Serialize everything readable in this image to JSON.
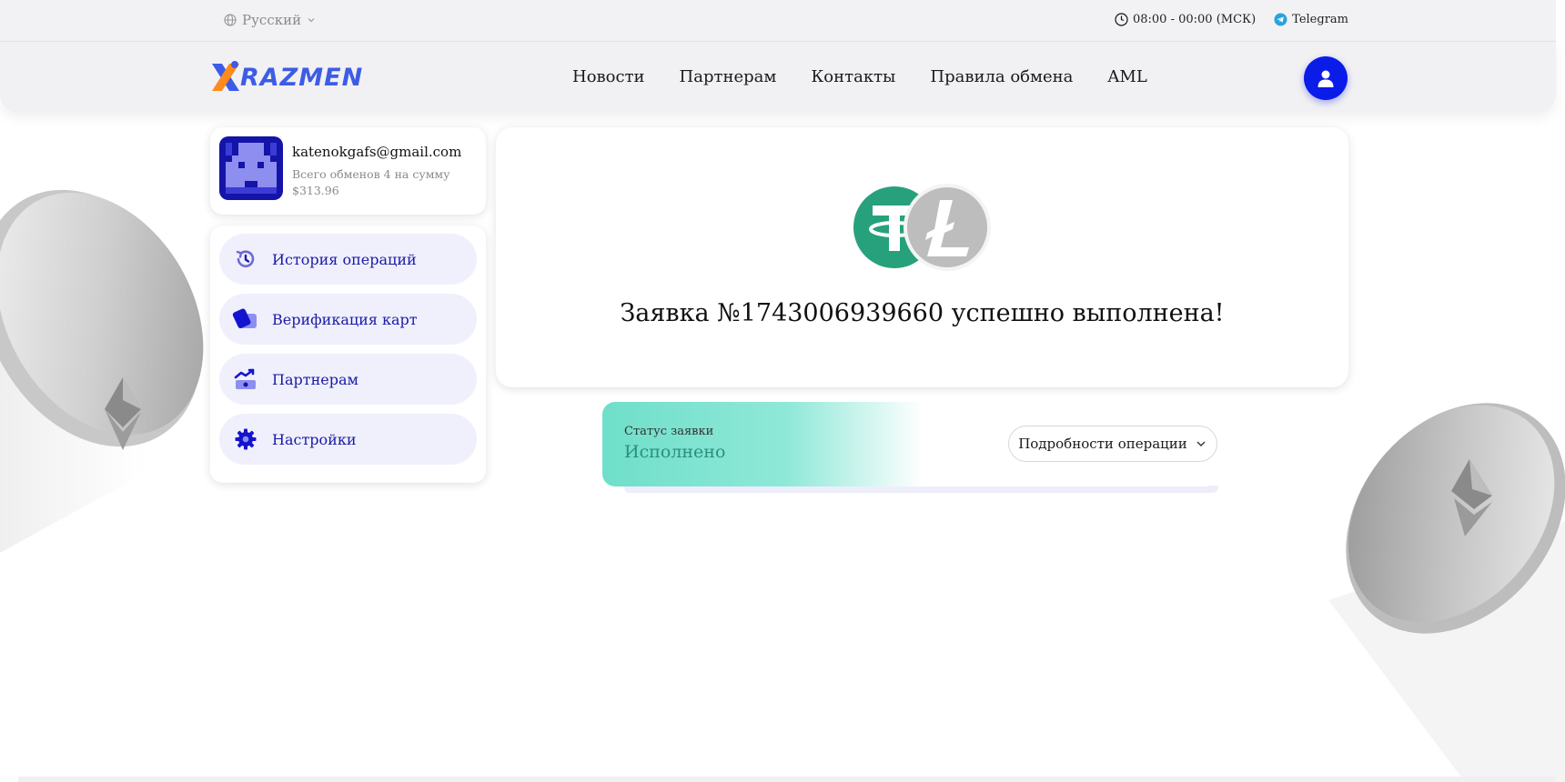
{
  "topbar": {
    "language": "Русский",
    "hours": "08:00 - 00:00 (МСК)",
    "telegram": "Telegram"
  },
  "header": {
    "logo_text": "RAZMEN",
    "nav": [
      "Новости",
      "Партнерам",
      "Контакты",
      "Правила обмена",
      "AML"
    ]
  },
  "profile": {
    "email": "katenokgafs@gmail.com",
    "summary": "Всего обменов 4 на сумму $313.96"
  },
  "menu": [
    {
      "label": "История операций",
      "icon": "history-icon"
    },
    {
      "label": "Верификация карт",
      "icon": "cards-icon"
    },
    {
      "label": "Партнерам",
      "icon": "partners-icon"
    },
    {
      "label": "Настройки",
      "icon": "settings-icon"
    }
  ],
  "order": {
    "title": "Заявка №1743006939660 успешно выполнена!",
    "from_coin": "tether-icon",
    "to_coin": "litecoin-icon"
  },
  "status": {
    "label": "Статус заявки",
    "value": "Исполнено",
    "details_button": "Подробности операции"
  },
  "colors": {
    "brand": "#3d5ce6",
    "user_button": "#0b1be8",
    "menu_text": "#1a1aa8",
    "status_green": "#2a8f7b",
    "tether": "#26a17b"
  }
}
